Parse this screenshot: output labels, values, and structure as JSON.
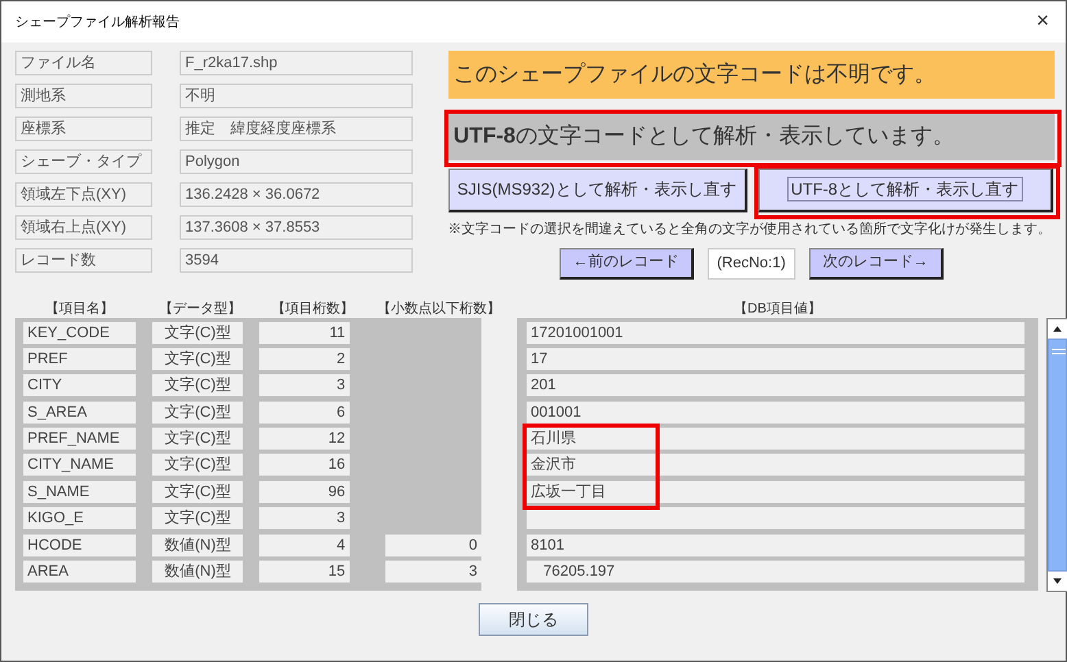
{
  "window": {
    "title": "シェープファイル解析報告",
    "close": "×"
  },
  "info": [
    {
      "label": "ファイル名",
      "value": "F_r2ka17.shp"
    },
    {
      "label": "測地系",
      "value": "不明"
    },
    {
      "label": "座標系",
      "value": "推定　緯度経度座標系"
    },
    {
      "label": "シェーブ・タイプ",
      "value": "Polygon"
    },
    {
      "label": "領域左下点(XY)",
      "value": "136.2428 × 36.0672"
    },
    {
      "label": "領域右上点(XY)",
      "value": "137.3608 × 37.8553"
    },
    {
      "label": "レコード数",
      "value": "3594"
    }
  ],
  "encoding_notice": "このシェープファイルの文字コードは不明です。",
  "parse_status": {
    "text": "**UTF-8**の文字コードとして解析・表示しています。",
    "highlighted": true
  },
  "reparse_buttons": [
    {
      "label": "SJIS(MS932)として解析・表示し直す",
      "focused": false,
      "highlighted": false
    },
    {
      "label": "UTF-8として解析・表示し直す",
      "focused": true,
      "highlighted": true
    }
  ],
  "note": "※文字コードの選択を間違えていると全角の文字が使用されている箇所で文字化けが発生します。",
  "navigation": {
    "prev": "←前のレコード",
    "record": "(RecNo:1)",
    "next": "次のレコード→"
  },
  "table": {
    "columns": [
      "【項目名】",
      "【データ型】",
      "【項目桁数】",
      "【小数点以下桁数】",
      "【DB項目値】"
    ],
    "rows": [
      {
        "name": "KEY_CODE",
        "type": "文字(C)型",
        "digits": "11",
        "value": "17201001001",
        "highlighted": false
      },
      {
        "name": "PREF",
        "type": "文字(C)型",
        "digits": "2",
        "value": "17",
        "highlighted": false
      },
      {
        "name": "CITY",
        "type": "文字(C)型",
        "digits": "3",
        "value": "201",
        "highlighted": false
      },
      {
        "name": "S_AREA",
        "type": "文字(C)型",
        "digits": "6",
        "value": "001001",
        "highlighted": false
      },
      {
        "name": "PREF_NAME",
        "type": "文字(C)型",
        "digits": "12",
        "value": "石川県",
        "highlighted": true
      },
      {
        "name": "CITY_NAME",
        "type": "文字(C)型",
        "digits": "16",
        "value": "金沢市",
        "highlighted": true
      },
      {
        "name": "S_NAME",
        "type": "文字(C)型",
        "digits": "96",
        "value": "広坂一丁目",
        "highlighted": true
      },
      {
        "name": "KIGO_E",
        "type": "文字(C)型",
        "digits": "3",
        "value": "",
        "highlighted": false
      },
      {
        "name": "HCODE",
        "type": "数値(N)型",
        "digits": "4",
        "decimals": "0",
        "value": "8101",
        "highlighted": false
      },
      {
        "name": "AREA",
        "type": "数値(N)型",
        "digits": "15",
        "decimals": "3",
        "value": "   76205.197",
        "highlighted": false
      }
    ]
  },
  "close_button": "閉じる"
}
